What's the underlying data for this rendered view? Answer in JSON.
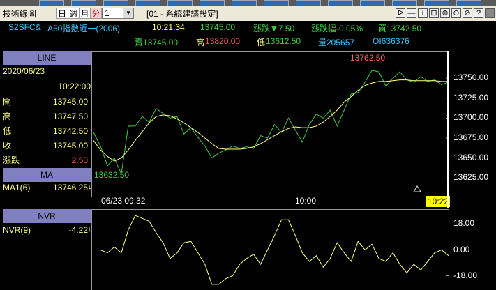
{
  "toolbar": {
    "title": "技術線圖",
    "periods": [
      "日",
      "週",
      "月",
      "分"
    ],
    "selected_period": "分",
    "interval_value": "1",
    "setting_label": "[01 - 系統建議設定]",
    "window_buttons": [
      "ᐅ",
      "—",
      "+",
      "⊟",
      "⊕",
      "⊖",
      "⊘",
      "?"
    ]
  },
  "quote": {
    "symbol": "S2SFC&",
    "name": "A50指數近一(2006)",
    "time": "10:21:34",
    "last": "13745.00",
    "change": "漲跌▼7.50",
    "change_pct": "漲跌幅-0.05%",
    "bid": "買13742.50",
    "ask": "賣13745.00",
    "high": "13820.00",
    "high_prefix": "高",
    "low": "13612.50",
    "low_prefix": "低",
    "volume": "量205657",
    "oi": "OI636376"
  },
  "left_panel": {
    "line_header": "LINE",
    "date": "2020/06/23",
    "time": "10:22:00",
    "rows": [
      {
        "label": "開",
        "value": "13745.00",
        "arrow": "↓",
        "color": "#ffff80"
      },
      {
        "label": "高",
        "value": "13747.50",
        "arrow": "↓",
        "color": "#ffff80"
      },
      {
        "label": "低",
        "value": "13742.50",
        "arrow": "↑",
        "color": "#ffff80"
      },
      {
        "label": "收",
        "value": "13745.00",
        "arrow": "↑",
        "color": "#ffff80"
      },
      {
        "label": "漲跌",
        "value": "2.50",
        "arrow": "↑",
        "color": "#ff5050"
      }
    ],
    "ma_header": "MA",
    "ma_label": "MA1(6)",
    "ma_value": "13746.25",
    "ma_arrow": "↓",
    "nvr_header": "NVR",
    "nvr_label": "NVR(9)",
    "nvr_value": "-4.22",
    "nvr_arrow": "↓"
  },
  "chart_data": [
    {
      "type": "line",
      "y_ticks": [
        "13750.00",
        "13725.00",
        "13700.00",
        "13675.00",
        "13650.00",
        "13625.00"
      ],
      "ylim": [
        13605,
        13780
      ],
      "max_label": "13762.50",
      "min_label": "13632.50",
      "x_labels": [
        "06/23 09:32",
        "10:00"
      ],
      "current_time": "10:22",
      "series": [
        {
          "color": "#44cc44",
          "values": [
            13682,
            13665,
            13640,
            13650,
            13630,
            13690,
            13690,
            13702,
            13695,
            13712,
            13706,
            13700,
            13702,
            13680,
            13688,
            13676,
            13665,
            13650,
            13656,
            13660,
            13665,
            13662,
            13664,
            13662,
            13678,
            13675,
            13692,
            13682,
            13700,
            13685,
            13670,
            13692,
            13705,
            13700,
            13710,
            13690,
            13710,
            13730,
            13732,
            13745,
            13760,
            13758,
            13740,
            13750,
            13758,
            13748,
            13745,
            13752,
            13746,
            13748,
            13742,
            13745
          ]
        },
        {
          "color": "#ffff80",
          "values": [
            13672,
            13660,
            13652,
            13646,
            13650,
            13660,
            13672,
            13683,
            13694,
            13702,
            13704,
            13703,
            13699,
            13694,
            13688,
            13682,
            13675,
            13668,
            13662,
            13661,
            13661,
            13661,
            13662,
            13664,
            13668,
            13673,
            13678,
            13683,
            13687,
            13689,
            13688,
            13688,
            13690,
            13695,
            13702,
            13710,
            13720,
            13727,
            13735,
            13741,
            13744,
            13746,
            13746,
            13747,
            13748,
            13748,
            13747,
            13747,
            13747,
            13747,
            13746,
            13746
          ]
        }
      ]
    },
    {
      "type": "line",
      "y_ticks": [
        "18.00",
        "0.00",
        "-18.00"
      ],
      "ylim": [
        -26,
        26
      ],
      "series": [
        {
          "color": "#ffff80",
          "values": [
            0,
            0,
            -2,
            2,
            -2,
            14,
            24,
            22,
            20,
            12,
            5,
            -6,
            -2,
            5,
            6,
            -2,
            -10,
            -24,
            -24,
            -20,
            -18,
            -10,
            -6,
            -3,
            -10,
            0,
            10,
            21,
            21,
            10,
            -2,
            -8,
            -4,
            -12,
            -6,
            5,
            -2,
            -8,
            6,
            0,
            4,
            -6,
            -8,
            -2,
            -10,
            -16,
            -10,
            -14,
            -8,
            -2,
            0,
            -4
          ]
        }
      ]
    }
  ]
}
